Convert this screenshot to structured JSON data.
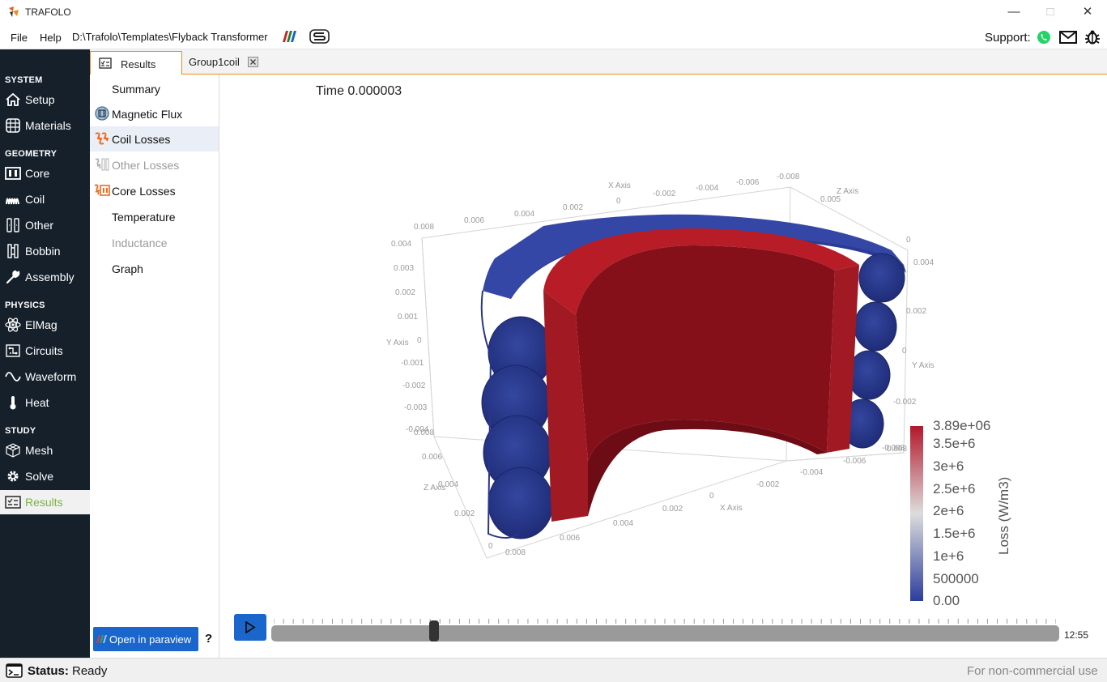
{
  "app": {
    "title": "TRAFOLO"
  },
  "menu": {
    "file": "File",
    "help": "Help",
    "path": "D:\\Trafolo\\Templates\\Flyback Transformer",
    "support": "Support:"
  },
  "sidebar": {
    "sections": [
      {
        "title": "SYSTEM",
        "items": [
          {
            "label": "Setup",
            "icon": "home-icon"
          },
          {
            "label": "Materials",
            "icon": "grid-globe-icon"
          }
        ]
      },
      {
        "title": "GEOMETRY",
        "items": [
          {
            "label": "Core",
            "icon": "core-icon"
          },
          {
            "label": "Coil",
            "icon": "coil-icon"
          },
          {
            "label": "Other",
            "icon": "other-icon"
          },
          {
            "label": "Bobbin",
            "icon": "bobbin-icon"
          },
          {
            "label": "Assembly",
            "icon": "wrench-icon"
          }
        ]
      },
      {
        "title": "PHYSICS",
        "items": [
          {
            "label": "ElMag",
            "icon": "atom-icon"
          },
          {
            "label": "Circuits",
            "icon": "circuit-icon"
          },
          {
            "label": "Waveform",
            "icon": "sine-icon"
          },
          {
            "label": "Heat",
            "icon": "thermometer-icon"
          }
        ]
      },
      {
        "title": "STUDY",
        "items": [
          {
            "label": "Mesh",
            "icon": "cube-mesh-icon"
          },
          {
            "label": "Solve",
            "icon": "gear-icon"
          },
          {
            "label": "Results",
            "icon": "checklist-icon"
          }
        ]
      }
    ],
    "active": "Results"
  },
  "tabs": {
    "results": "Results",
    "group": "Group1coil"
  },
  "results_nav": {
    "items": [
      {
        "label": "Summary",
        "state": "normal"
      },
      {
        "label": "Magnetic Flux",
        "state": "normal"
      },
      {
        "label": "Coil Losses",
        "state": "selected"
      },
      {
        "label": "Other Losses",
        "state": "dim"
      },
      {
        "label": "Core Losses",
        "state": "normal"
      },
      {
        "label": "Temperature",
        "state": "normal"
      },
      {
        "label": "Inductance",
        "state": "dim"
      },
      {
        "label": "Graph",
        "state": "normal"
      }
    ],
    "paraview_button": "Open in paraview",
    "help": "?"
  },
  "viewer": {
    "time_label": "Time 0.000003",
    "axis_labels": {
      "x_top": "X Axis",
      "z_top": "Z Axis",
      "y_left": "Y Axis",
      "y_right": "Y Axis",
      "z_left": "Z Axis",
      "x_bottom": "X Axis"
    },
    "ticks": {
      "top_x": [
        "0.008",
        "0.006",
        "0.004",
        "0.002",
        "0",
        "-0.002",
        "-0.004",
        "-0.006",
        "-0.008"
      ],
      "top_z": [
        "0.005",
        "0"
      ],
      "left_y": [
        "0.004",
        "0.003",
        "0.002",
        "0.001",
        "0",
        "-0.001",
        "-0.002",
        "-0.003",
        "-0.004"
      ],
      "right_y": [
        "0.004",
        "0.002",
        "0",
        "-0.002"
      ],
      "left_z": [
        "0.008",
        "0.006",
        "0.004",
        "0.002",
        "0"
      ],
      "bottom_x": [
        "0.008",
        "0.006",
        "0.004",
        "0.002",
        "0",
        "-0.002",
        "-0.004",
        "-0.006",
        "-0.008"
      ],
      "right_x_extra": "0.008"
    },
    "colorbar": {
      "title": "Loss (W/m3)",
      "labels": [
        "3.89e+06",
        "3.5e+6",
        "3e+6",
        "2.5e+6",
        "2e+6",
        "1.5e+6",
        "1e+6",
        "500000",
        "0.00"
      ],
      "min": 0,
      "max": 3890000,
      "colors": {
        "high": "#b2182b",
        "mid": "#dddddd",
        "low": "#2c3d9c"
      }
    },
    "colors": {
      "coil": "#2b3a8f",
      "core_front": "#a11922",
      "core_inner": "#7a0e18"
    }
  },
  "playback": {
    "progress": 0.207,
    "timecode": "12:55"
  },
  "status": {
    "label": "Status:",
    "value": "Ready",
    "license": "For non-commercial use"
  }
}
